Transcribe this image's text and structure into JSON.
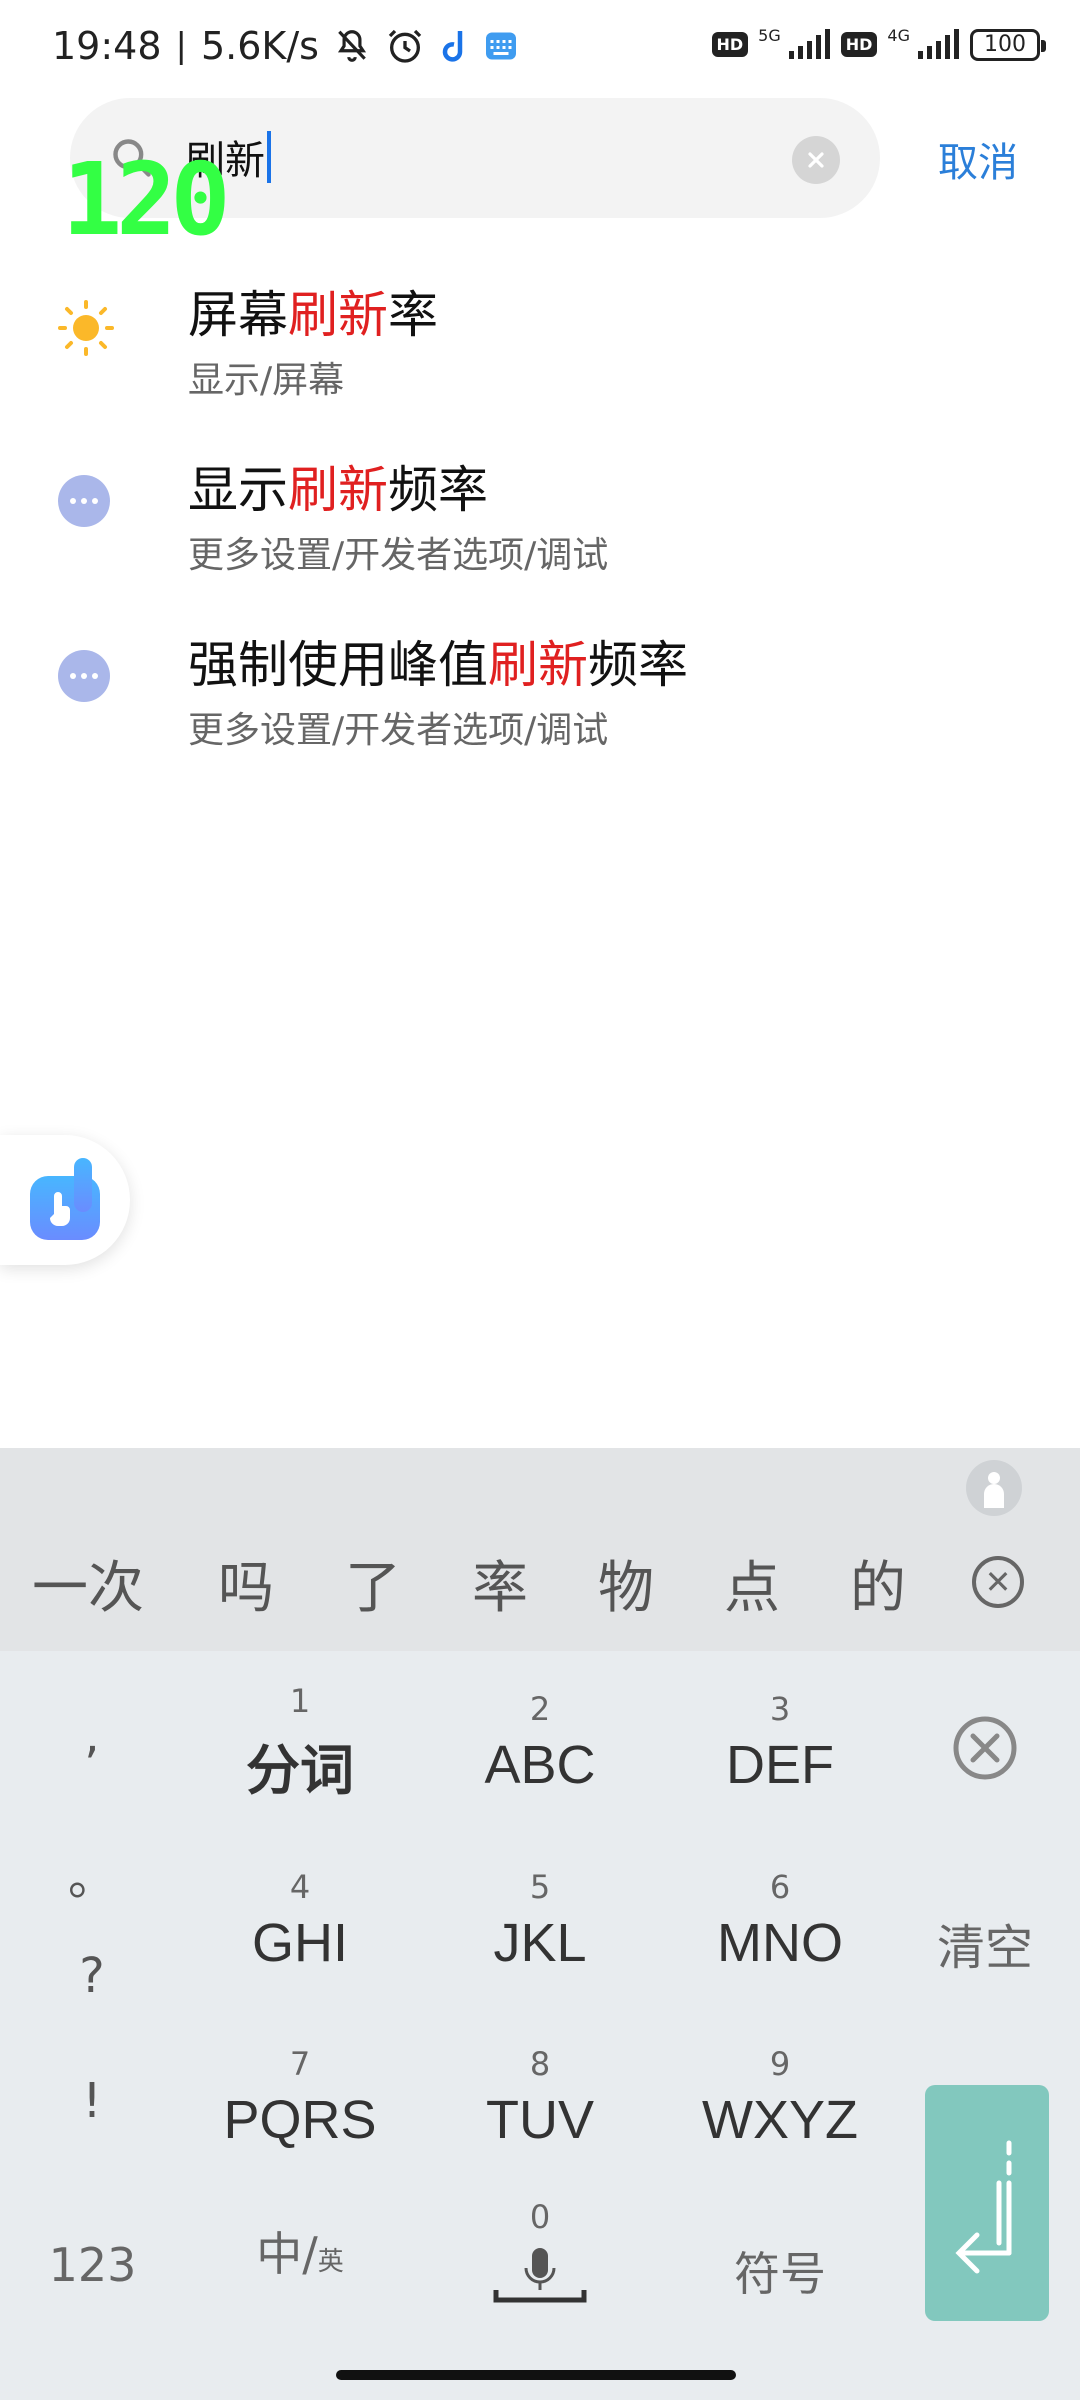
{
  "status_bar": {
    "time": "19:48",
    "speed": "5.6K/s",
    "net1": "5G",
    "net2": "4G",
    "hd": "HD",
    "battery": "100"
  },
  "search": {
    "query": "刷新",
    "cancel_label": "取消"
  },
  "fps_overlay": "120",
  "results": [
    {
      "title_pre": "屏幕",
      "title_hl": "刷新",
      "title_post": "率",
      "path": "显示/屏幕",
      "icon": "brightness-icon"
    },
    {
      "title_pre": "显示",
      "title_hl": "刷新",
      "title_post": "频率",
      "path": "更多设置/开发者选项/调试",
      "icon": "more-icon"
    },
    {
      "title_pre": "强制使用峰值",
      "title_hl": "刷新",
      "title_post": "频率",
      "path": "更多设置/开发者选项/调试",
      "icon": "more-icon"
    }
  ],
  "keyboard": {
    "candidates": [
      "一次",
      "吗",
      "了",
      "率",
      "物",
      "点",
      "的"
    ],
    "keys": [
      {
        "num": "1",
        "label": "分词"
      },
      {
        "num": "2",
        "label": "ABC"
      },
      {
        "num": "3",
        "label": "DEF"
      },
      {
        "num": "4",
        "label": "GHI"
      },
      {
        "num": "5",
        "label": "JKL"
      },
      {
        "num": "6",
        "label": "MNO"
      },
      {
        "num": "7",
        "label": "PQRS"
      },
      {
        "num": "8",
        "label": "TUV"
      },
      {
        "num": "9",
        "label": "WXYZ"
      },
      {
        "num": "0",
        "label": ""
      }
    ],
    "punct": [
      ",",
      "。",
      "?",
      "!"
    ],
    "clear_label": "清空",
    "num_label": "123",
    "lang_label": "中/",
    "lang_sub": "英",
    "symbol_label": "符号"
  },
  "colors": {
    "highlight": "#e02020",
    "accent": "#2b7fd9",
    "enter": "#82c8be"
  }
}
